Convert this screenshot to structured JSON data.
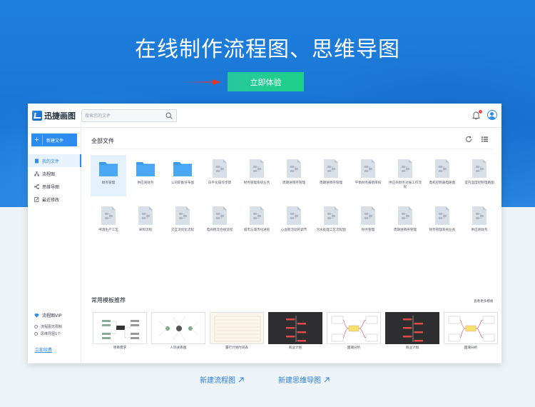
{
  "hero": {
    "title": "在线制作流程图、思维导图",
    "cta_label": "立即体验"
  },
  "app": {
    "logo_text": "迅捷画图",
    "search_placeholder": "搜索您的文件",
    "sidebar": {
      "new_file_label": "新建文件",
      "items": [
        {
          "label": "我的文件",
          "icon": "file-icon",
          "active": true
        },
        {
          "label": "流程图",
          "icon": "flowchart-icon",
          "active": false
        },
        {
          "label": "思维导图",
          "icon": "mindmap-icon",
          "active": false
        },
        {
          "label": "最近修改",
          "icon": "edit-icon",
          "active": false
        }
      ],
      "vip_label": "流程图VIP",
      "vip_features": [
        "流程图无限制",
        "思维导图1个"
      ],
      "renew_label": "立即续费"
    },
    "content": {
      "section_title": "全部文件",
      "files_row1": [
        {
          "name": "财务管理",
          "type": "folder"
        },
        {
          "name": "供应商财务",
          "type": "folder"
        },
        {
          "name": "公司职能分布图",
          "type": "folder"
        },
        {
          "name": "白平化操作步骤",
          "type": "doc"
        },
        {
          "name": "财务管理系统业务",
          "type": "doc"
        },
        {
          "name": "周期进销存管理",
          "type": "doc"
        },
        {
          "name": "周期进销存管理",
          "type": "doc"
        },
        {
          "name": "平衡财务报销审核",
          "type": "doc"
        },
        {
          "name": "供应商财务对账工作流程",
          "type": "doc"
        },
        {
          "name": "电机控制器电路图",
          "type": "doc"
        },
        {
          "name": "室内温度控制电路图",
          "type": "doc"
        }
      ],
      "files_row2": [
        {
          "name": "啤酒生产工艺",
          "type": "doc"
        },
        {
          "name": "采购流程",
          "type": "doc"
        },
        {
          "name": "交互流优化流程",
          "type": "doc"
        },
        {
          "name": "电商税流合规流程",
          "type": "doc"
        },
        {
          "name": "城市与城市化进程",
          "type": "doc"
        },
        {
          "name": "心血管活动的调节",
          "type": "doc"
        },
        {
          "name": "污水处理工艺流程图",
          "type": "doc"
        },
        {
          "name": "财务管理",
          "type": "doc"
        },
        {
          "name": "周期进销存管理",
          "type": "doc"
        },
        {
          "name": "财务管理系统业务",
          "type": "doc"
        },
        {
          "name": "供应商财务",
          "type": "doc"
        }
      ],
      "templates_title": "常用模板推荐",
      "templates_more": "查看更多模板",
      "templates": [
        {
          "name": "项目需求",
          "style": "light"
        },
        {
          "name": "人际关系图",
          "style": "light"
        },
        {
          "name": "置行计划时间表",
          "style": "cream"
        },
        {
          "name": "商业计划",
          "style": "dark"
        },
        {
          "name": "国潮分析",
          "style": "light"
        },
        {
          "name": "商业计划",
          "style": "dark"
        },
        {
          "name": "国潮分析",
          "style": "light"
        }
      ]
    }
  },
  "bottom_links": [
    {
      "label": "新建流程图"
    },
    {
      "label": "新建思维导图"
    }
  ],
  "colors": {
    "brand_blue": "#2c8cf0",
    "hero_blue": "#1974d4",
    "cta_green": "#22cc90",
    "arrow_red": "#e8322e"
  }
}
